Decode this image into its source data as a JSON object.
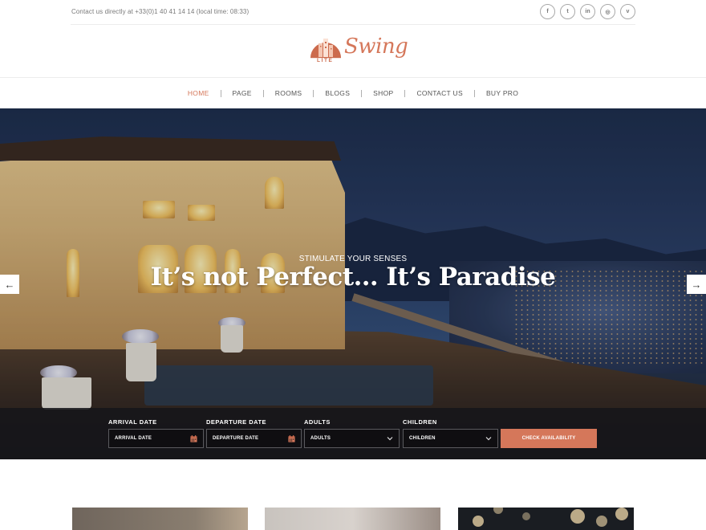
{
  "topbar": {
    "contact_text": "Contact us directly at +33(0)1 40 41 14 14 (local time: 08:33)",
    "social": [
      {
        "icon": "facebook-icon",
        "glyph": "f"
      },
      {
        "icon": "twitter-icon",
        "glyph": "t"
      },
      {
        "icon": "linkedin-icon",
        "glyph": "in"
      },
      {
        "icon": "instagram-icon",
        "glyph": "◎"
      },
      {
        "icon": "vimeo-icon",
        "glyph": "v"
      }
    ]
  },
  "logo": {
    "name": "Swing",
    "sub": "LITE"
  },
  "nav": {
    "items": [
      "HOME",
      "PAGE",
      "ROOMS",
      "BLOGS",
      "SHOP",
      "CONTACT US",
      "BUY PRO"
    ],
    "active": "HOME"
  },
  "hero": {
    "eyebrow": "STIMULATE YOUR SENSES",
    "title": "It’s not Perfect… It’s Paradise",
    "prev_arrow": "←",
    "next_arrow": "→"
  },
  "booking": {
    "arrival": {
      "label": "ARRIVAL DATE",
      "value": "ARRIVAL DATE",
      "icon": "calendar-icon"
    },
    "departure": {
      "label": "DEPARTURE DATE",
      "value": "DEPARTURE DATE",
      "icon": "calendar-icon"
    },
    "adults": {
      "label": "ADULTS",
      "value": "ADULTS",
      "icon": "chevron-down-icon"
    },
    "children": {
      "label": "CHILDREN",
      "value": "CHILDREN",
      "icon": "chevron-down-icon"
    },
    "button": "CHECK AVAILABILITY"
  },
  "colors": {
    "accent": "#d5775a",
    "booking_bar": "#16161a"
  }
}
